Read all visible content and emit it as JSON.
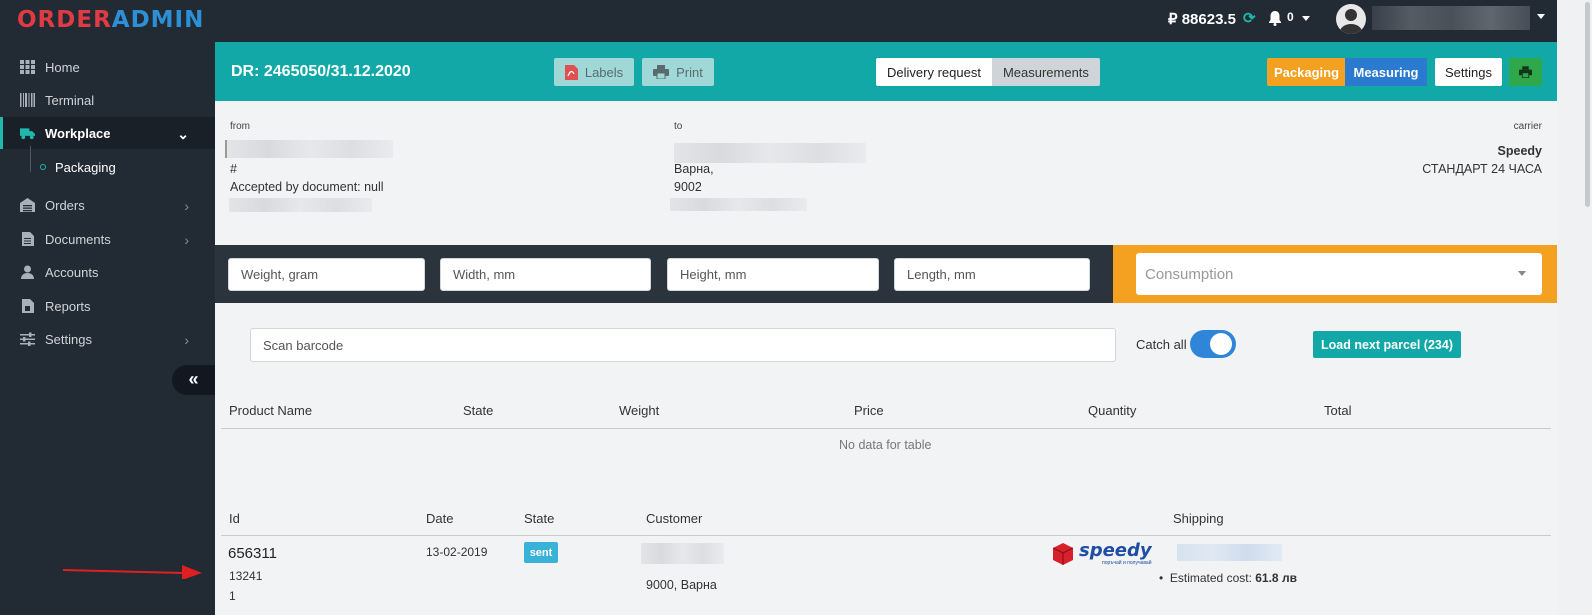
{
  "app": {
    "logo_part1": "ORDER",
    "logo_part2": "ADMIN"
  },
  "topbar": {
    "balance": "₽ 88623.5",
    "notifications": "0"
  },
  "sidebar": {
    "items": [
      {
        "label": "Home",
        "icon": "grid-icon"
      },
      {
        "label": "Terminal",
        "icon": "barcode-icon"
      },
      {
        "label": "Workplace",
        "icon": "truck-icon"
      },
      {
        "label": "Packaging",
        "icon": "circle-icon"
      },
      {
        "label": "Orders",
        "icon": "warehouse-icon"
      },
      {
        "label": "Documents",
        "icon": "document-icon"
      },
      {
        "label": "Accounts",
        "icon": "user-icon"
      },
      {
        "label": "Reports",
        "icon": "report-icon"
      },
      {
        "label": "Settings",
        "icon": "sliders-icon"
      }
    ],
    "collapse": "«"
  },
  "header": {
    "title": "DR: 2465050/31.12.2020",
    "labels_btn": "Labels",
    "print_btn": "Print",
    "tab_delivery": "Delivery request",
    "tab_measurements": "Measurements",
    "packaging_btn": "Packaging",
    "measuring_btn": "Measuring",
    "settings_btn": "Settings",
    "colors": {
      "teal": "#13a8a8",
      "orange": "#f4a020",
      "blue": "#2a7ad0",
      "green": "#2ea84a"
    }
  },
  "info": {
    "from_label": "from",
    "from_hash": "#",
    "accepted": "Accepted by document: null",
    "to_label": "to",
    "to_city": "Варна,",
    "to_zip": "9002",
    "carrier_label": "carrier",
    "carrier_name": "Speedy",
    "carrier_service": "СТАНДАРТ 24 ЧАСА"
  },
  "dimensions": {
    "weight": "Weight, gram",
    "width": "Width, mm",
    "height": "Height, mm",
    "length": "Length, mm",
    "consumption": "Consumption"
  },
  "scan": {
    "placeholder": "Scan barcode",
    "catch_all": "Catch all",
    "load_next": "Load next parcel (234)"
  },
  "products_table": {
    "headers": [
      "Product Name",
      "State",
      "Weight",
      "Price",
      "Quantity",
      "Total"
    ],
    "empty": "No data for table"
  },
  "orders_table": {
    "headers": [
      "Id",
      "Date",
      "State",
      "Customer",
      "Shipping"
    ],
    "row": {
      "id": "656311",
      "sub_id": "13241",
      "count": "1",
      "date": "13-02-2019",
      "state": "sent",
      "customer_address": "9000, Варна",
      "shipping_logo": "speedy",
      "shipping_logo_sub": "поръчай и получавай",
      "estimated_label": "Estimated cost: ",
      "estimated_value": "61.8 лв"
    }
  }
}
